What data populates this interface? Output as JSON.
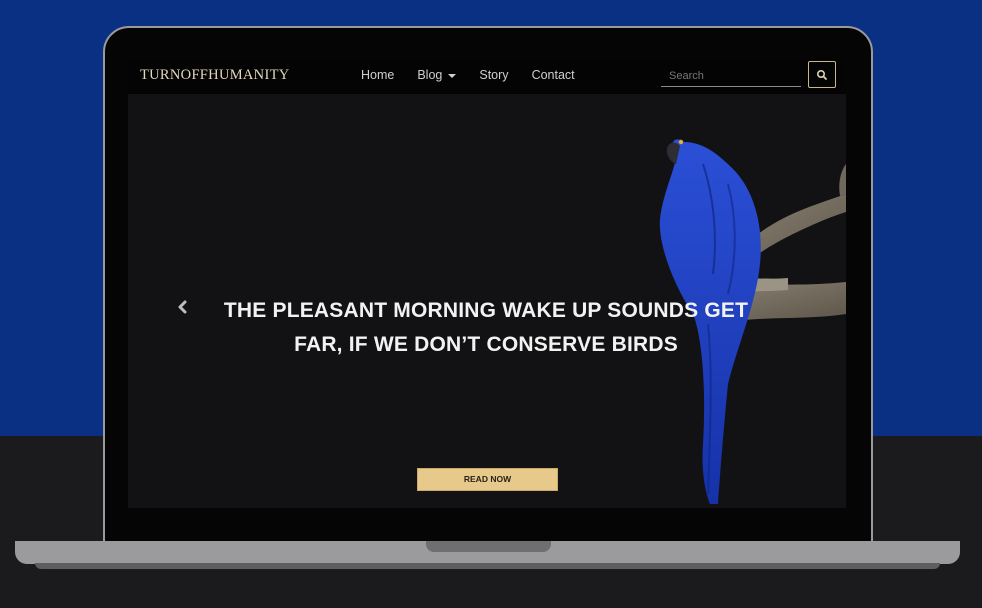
{
  "nav": {
    "brand": "TURNOFFHUMANITY",
    "links": [
      "Home",
      "Blog",
      "Story",
      "Contact"
    ],
    "search_placeholder": "Search"
  },
  "hero": {
    "headline_line1": "THE PLEASANT MORNING WAKE UP SOUNDS GET",
    "headline_line2": "FAR, IF WE DON’T CONSERVE BIRDS",
    "cta_label": "READ NOW"
  },
  "colors": {
    "backdrop_blue": "#0a3083",
    "accent_gold": "#e6c98b",
    "parrot_blue": "#1f3fc4"
  },
  "icons": [
    "search-icon",
    "chevron-left-icon",
    "caret-down-icon"
  ]
}
